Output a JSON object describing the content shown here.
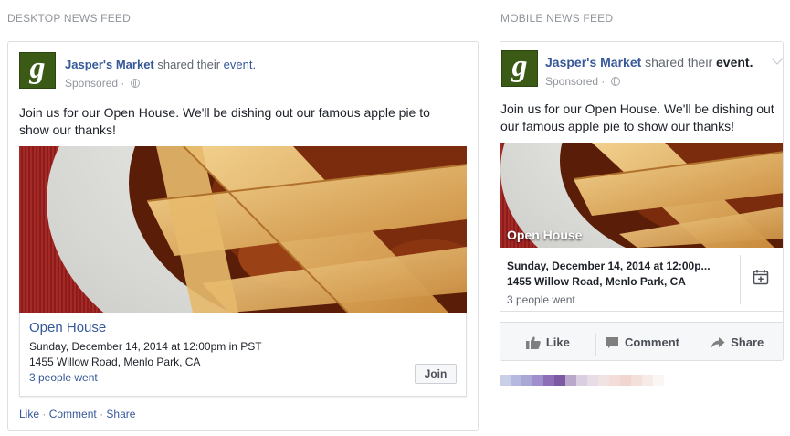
{
  "desktop_section": {
    "title": "DESKTOP NEWS FEED"
  },
  "mobile_section": {
    "title": "MOBILE NEWS FEED"
  },
  "post": {
    "logo_letter": "g",
    "page_name": "Jasper's Market",
    "headline_mid": "shared their",
    "headline_event": "event.",
    "sponsored": "Sponsored ·",
    "body": "Join us for our Open House. We'll be dishing out our famous apple pie to show our thanks!"
  },
  "event": {
    "title": "Open House",
    "date": "Sunday, December 14, 2014 at 12:00pm in PST",
    "date_mobile": "Sunday, December 14, 2014 at 12:00p...",
    "location": "1455 Willow Road, Menlo Park, CA",
    "went": "3 people went",
    "join_label": "Join"
  },
  "desktop_actions": {
    "like": "Like",
    "comment": "Comment",
    "share": "Share",
    "separator": "·"
  },
  "mobile_actions": {
    "like": "Like",
    "comment": "Comment",
    "share": "Share"
  },
  "icons": [
    "globe-icon",
    "chevron-down-icon",
    "calendar-add-icon",
    "thumbs-up-icon",
    "comment-icon",
    "share-arrow-icon"
  ],
  "colors": {
    "link_blue": "#365899",
    "logo_green": "#3a5a16",
    "border": "#dddfe2",
    "muted": "#90949c"
  }
}
